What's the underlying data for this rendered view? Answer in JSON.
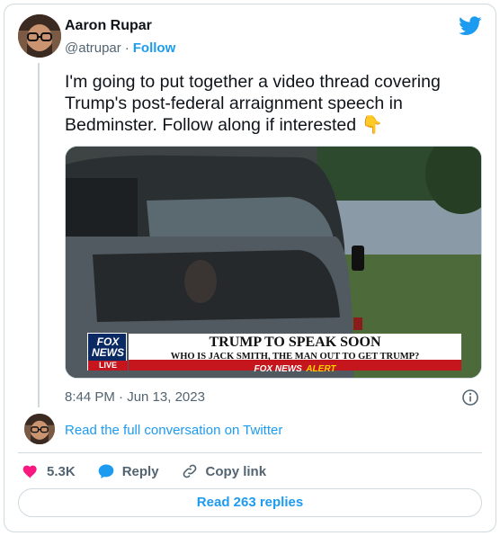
{
  "author": {
    "name": "Aaron Rupar",
    "handle": "@atrupar",
    "separator": "·",
    "follow_label": "Follow"
  },
  "tweet": {
    "text": "I'm going to put together a video thread covering Trump's post-federal arraignment speech in Bedminster. Follow along if interested 👇",
    "timestamp": "8:44 PM · Jun 13, 2023"
  },
  "media": {
    "network_logo_line1": "FOX",
    "network_logo_line2": "NEWS",
    "live_badge": "LIVE",
    "headline": "TRUMP TO SPEAK SOON",
    "subheadline": "WHO IS JACK SMITH, THE MAN OUT TO GET TRUMP?",
    "alert_brand": "FOX NEWS",
    "alert_label": "ALERT"
  },
  "conversation": {
    "link_label": "Read the full conversation on Twitter"
  },
  "actions": {
    "likes": "5.3K",
    "reply_label": "Reply",
    "copy_link_label": "Copy link",
    "read_replies_label": "Read 263 replies"
  },
  "colors": {
    "accent": "#1d9bf0",
    "like": "#f91880",
    "text_secondary": "#536471",
    "border": "#cfd9de"
  },
  "icons": [
    "twitter-bird-icon",
    "info-icon",
    "heart-icon",
    "reply-bubble-icon",
    "link-icon"
  ]
}
